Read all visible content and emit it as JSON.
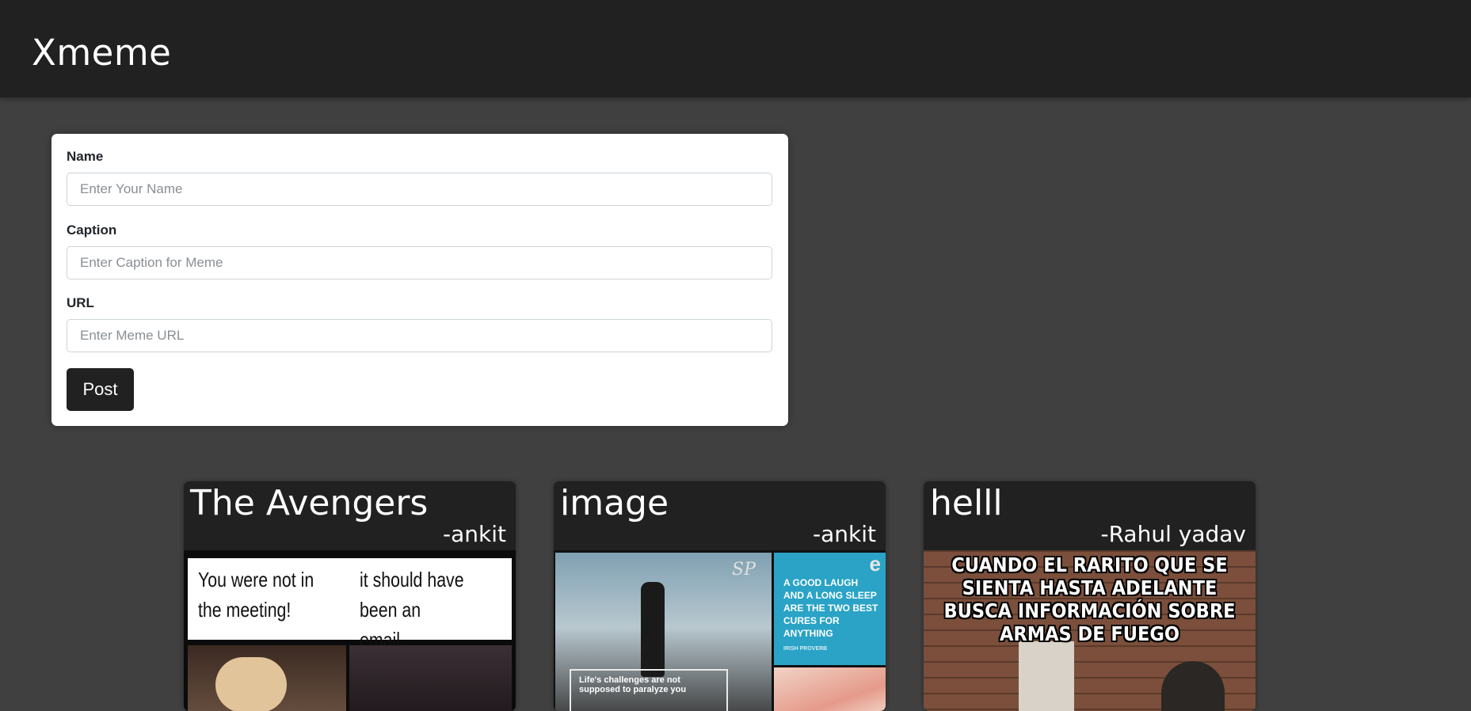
{
  "navbar": {
    "brand": "Xmeme"
  },
  "form": {
    "name_label": "Name",
    "name_placeholder": "Enter Your Name",
    "name_value": "",
    "caption_label": "Caption",
    "caption_placeholder": "Enter Caption for Meme",
    "caption_value": "",
    "url_label": "URL",
    "url_placeholder": "Enter Meme URL",
    "url_value": "",
    "submit_label": "Post"
  },
  "memes": [
    {
      "caption": "The Avengers",
      "author": "-ankit",
      "image_text_left": "You were not in the meeting!",
      "image_text_right": "it should have been an email."
    },
    {
      "caption": "image",
      "author": "-ankit",
      "image_text_box": "A GOOD LAUGH AND A LONG SLEEP ARE THE TWO BEST CURES FOR ANYTHING",
      "image_text_source": "IRISH PROVERB",
      "image_text_quote": "Life's challenges are not supposed to paralyze you"
    },
    {
      "caption": "helll",
      "author": "-Rahul yadav",
      "image_text": "CUANDO EL RARITO QUE SE SIENTA HASTA ADELANTE BUSCA INFORMACIÓN SOBRE ARMAS DE FUEGO"
    }
  ],
  "colors": {
    "navbar_bg": "#212121",
    "page_bg": "#404040",
    "card_bg": "#212121",
    "button_bg": "#212121",
    "text_light": "#ffffff"
  }
}
